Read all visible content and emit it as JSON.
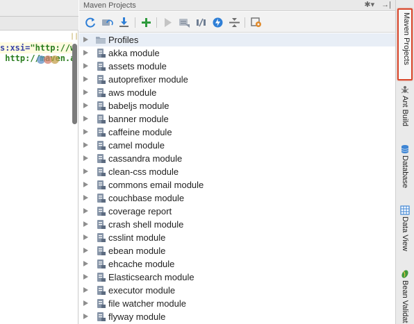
{
  "editor": {
    "line1": {
      "key": "s:xsi=",
      "value": "\"http://ww"
    },
    "line2": {
      "value": " http://maven.apa"
    },
    "gutter_mark": "||"
  },
  "maven_panel": {
    "title": "Maven Projects",
    "header_icons": [
      "gear-icon",
      "hide-icon"
    ],
    "header_icon_glyphs": {
      "gear": "✱▾",
      "hide": "→|"
    },
    "toolbar_icons": [
      "reimport-icon",
      "generate-sources-icon",
      "download-icon",
      "add-icon",
      "run-icon",
      "execute-goal-icon",
      "toggle-offline-icon",
      "skip-tests-icon",
      "collapse-all-icon",
      "settings-icon"
    ],
    "tree": [
      {
        "label": "Profiles",
        "type": "folder",
        "selected": true
      },
      {
        "label": "akka module",
        "type": "module"
      },
      {
        "label": "assets module",
        "type": "module"
      },
      {
        "label": "autoprefixer module",
        "type": "module"
      },
      {
        "label": "aws module",
        "type": "module"
      },
      {
        "label": "babeljs module",
        "type": "module"
      },
      {
        "label": "banner module",
        "type": "module"
      },
      {
        "label": "caffeine module",
        "type": "module"
      },
      {
        "label": "camel module",
        "type": "module"
      },
      {
        "label": "cassandra module",
        "type": "module"
      },
      {
        "label": "clean-css module",
        "type": "module"
      },
      {
        "label": "commons email module",
        "type": "module"
      },
      {
        "label": "couchbase module",
        "type": "module"
      },
      {
        "label": "coverage report",
        "type": "module"
      },
      {
        "label": "crash shell module",
        "type": "module"
      },
      {
        "label": "csslint module",
        "type": "module"
      },
      {
        "label": "ebean module",
        "type": "module"
      },
      {
        "label": "ehcache module",
        "type": "module"
      },
      {
        "label": "Elasticsearch module",
        "type": "module"
      },
      {
        "label": "executor module",
        "type": "module"
      },
      {
        "label": "file watcher module",
        "type": "module"
      },
      {
        "label": "flyway module",
        "type": "module"
      }
    ]
  },
  "right_strip": {
    "tabs": [
      {
        "label": "Maven Projects",
        "icon": null,
        "active": true
      },
      {
        "label": "Ant Build",
        "icon": "ant-icon",
        "active": false
      },
      {
        "label": "Database",
        "icon": "database-icon",
        "active": false
      },
      {
        "label": "Data View",
        "icon": "grid-icon",
        "active": false
      },
      {
        "label": "Bean Validat",
        "icon": "bean-icon",
        "active": false
      }
    ]
  },
  "colors": {
    "accent_highlight": "#d9472b",
    "selection_bg": "#e8eef6",
    "toolbar_blue": "#2f7fd6",
    "toolbar_green": "#2e9a3c"
  }
}
